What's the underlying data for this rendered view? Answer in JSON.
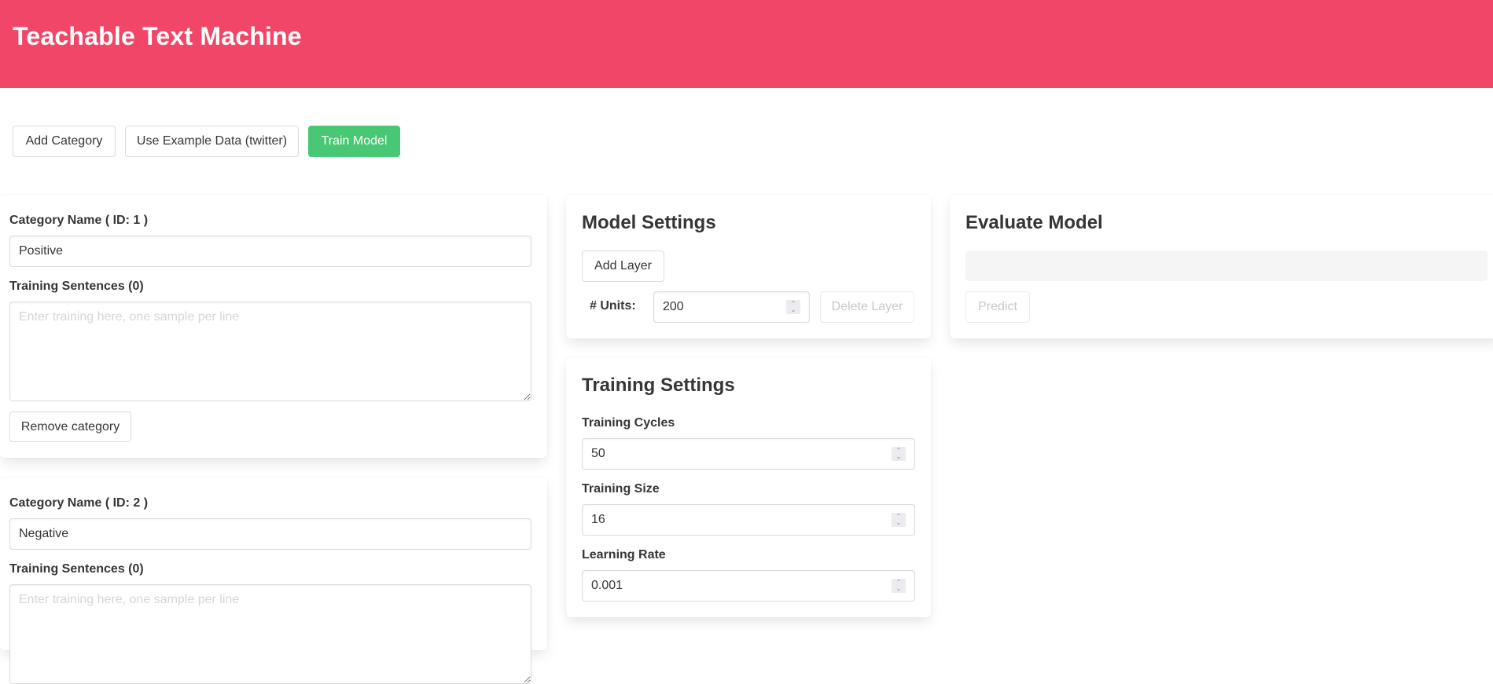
{
  "header": {
    "title": "Teachable Text Machine",
    "color": "#f14668"
  },
  "toolbar": {
    "add_category": "Add Category",
    "use_example": "Use Example Data (twitter)",
    "train_model": "Train Model",
    "train_color": "#48c774"
  },
  "categories": [
    {
      "name_label": "Category Name ( ID: 1 )",
      "name_value": "Positive",
      "sentences_label": "Training Sentences (0)",
      "sentences_placeholder": "Enter training here, one sample per line",
      "remove_label": "Remove category"
    },
    {
      "name_label": "Category Name ( ID: 2 )",
      "name_value": "Negative",
      "sentences_label": "Training Sentences (0)",
      "sentences_placeholder": "Enter training here, one sample per line"
    }
  ],
  "model_settings": {
    "title": "Model Settings",
    "add_layer": "Add Layer",
    "layers": [
      {
        "units_label": "# Units:",
        "units_value": "200",
        "delete_label": "Delete Layer"
      }
    ]
  },
  "training_settings": {
    "title": "Training Settings",
    "cycles_label": "Training Cycles",
    "cycles_value": "50",
    "size_label": "Training Size",
    "size_value": "16",
    "rate_label": "Learning Rate",
    "rate_value": "0.001"
  },
  "evaluate": {
    "title": "Evaluate Model",
    "input_value": "",
    "predict_label": "Predict"
  }
}
